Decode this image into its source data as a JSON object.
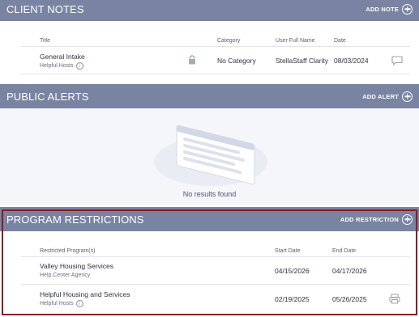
{
  "client_notes": {
    "title": "CLIENT NOTES",
    "action_label": "ADD NOTE",
    "columns": [
      "Title",
      "Category",
      "User Full Name",
      "Date"
    ],
    "rows": [
      {
        "title": "General Intake",
        "subtitle": "Helpful Hosts",
        "category": "No Category",
        "user": "StellaStaff Clarity",
        "date": "08/03/2024"
      }
    ]
  },
  "public_alerts": {
    "title": "PUBLIC ALERTS",
    "action_label": "ADD ALERT",
    "empty_text": "No results found"
  },
  "program_restrictions": {
    "title": "PROGRAM RESTRICTIONS",
    "action_label": "ADD RESTRICTION",
    "columns": [
      "Restricted Program(s)",
      "Start Date",
      "End Date"
    ],
    "rows": [
      {
        "program": "Valley Housing Services",
        "agency": "Help.Center Agency",
        "start": "04/15/2026",
        "end": "04/17/2026"
      },
      {
        "program": "Helpful Housing and Services",
        "agency": "Helpful Hosts",
        "start": "02/19/2025",
        "end": "05/26/2025"
      }
    ]
  },
  "colors": {
    "header_bg": "#7884a1",
    "highlight_border": "#8b1a24",
    "empty_bg": "#f5f6f9"
  },
  "icons": [
    "plus-circle-icon",
    "lock-icon",
    "comment-icon",
    "info-icon",
    "print-icon",
    "empty-list-illustration"
  ]
}
